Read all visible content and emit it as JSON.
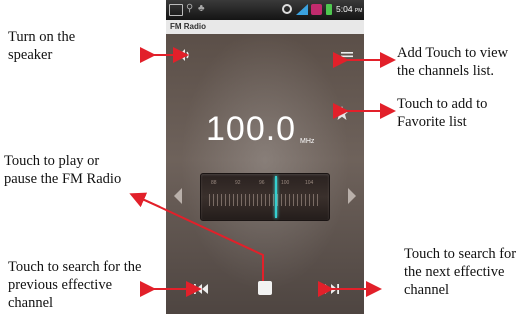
{
  "status_bar": {
    "time": "5:04",
    "ampm": "PM"
  },
  "app": {
    "title": "FM Radio"
  },
  "radio": {
    "frequency": "100.0",
    "unit": "MHz",
    "dial_numbers": [
      "88",
      "92",
      "96",
      "100",
      "104"
    ]
  },
  "icons": {
    "speaker": "speaker-icon",
    "list": "list-icon",
    "favorite": "star-icon",
    "prev_arrow": "left-arrow-icon",
    "next_arrow": "right-arrow-icon",
    "prev_channel": "seek-back-icon",
    "play_pause": "stop-icon",
    "next_channel": "seek-forward-icon"
  },
  "annotations": {
    "speaker": "Turn on the speaker",
    "list": "Add Touch to view the channels list.",
    "favorite": "Touch to add to Favorite list",
    "play": "Touch to play or pause the FM Radio",
    "prev": "Touch to search for the previous effective channel",
    "next": "Touch to search for the next effective channel"
  },
  "colors": {
    "needle": "#35d0d0",
    "arrow": "#e2202a"
  }
}
